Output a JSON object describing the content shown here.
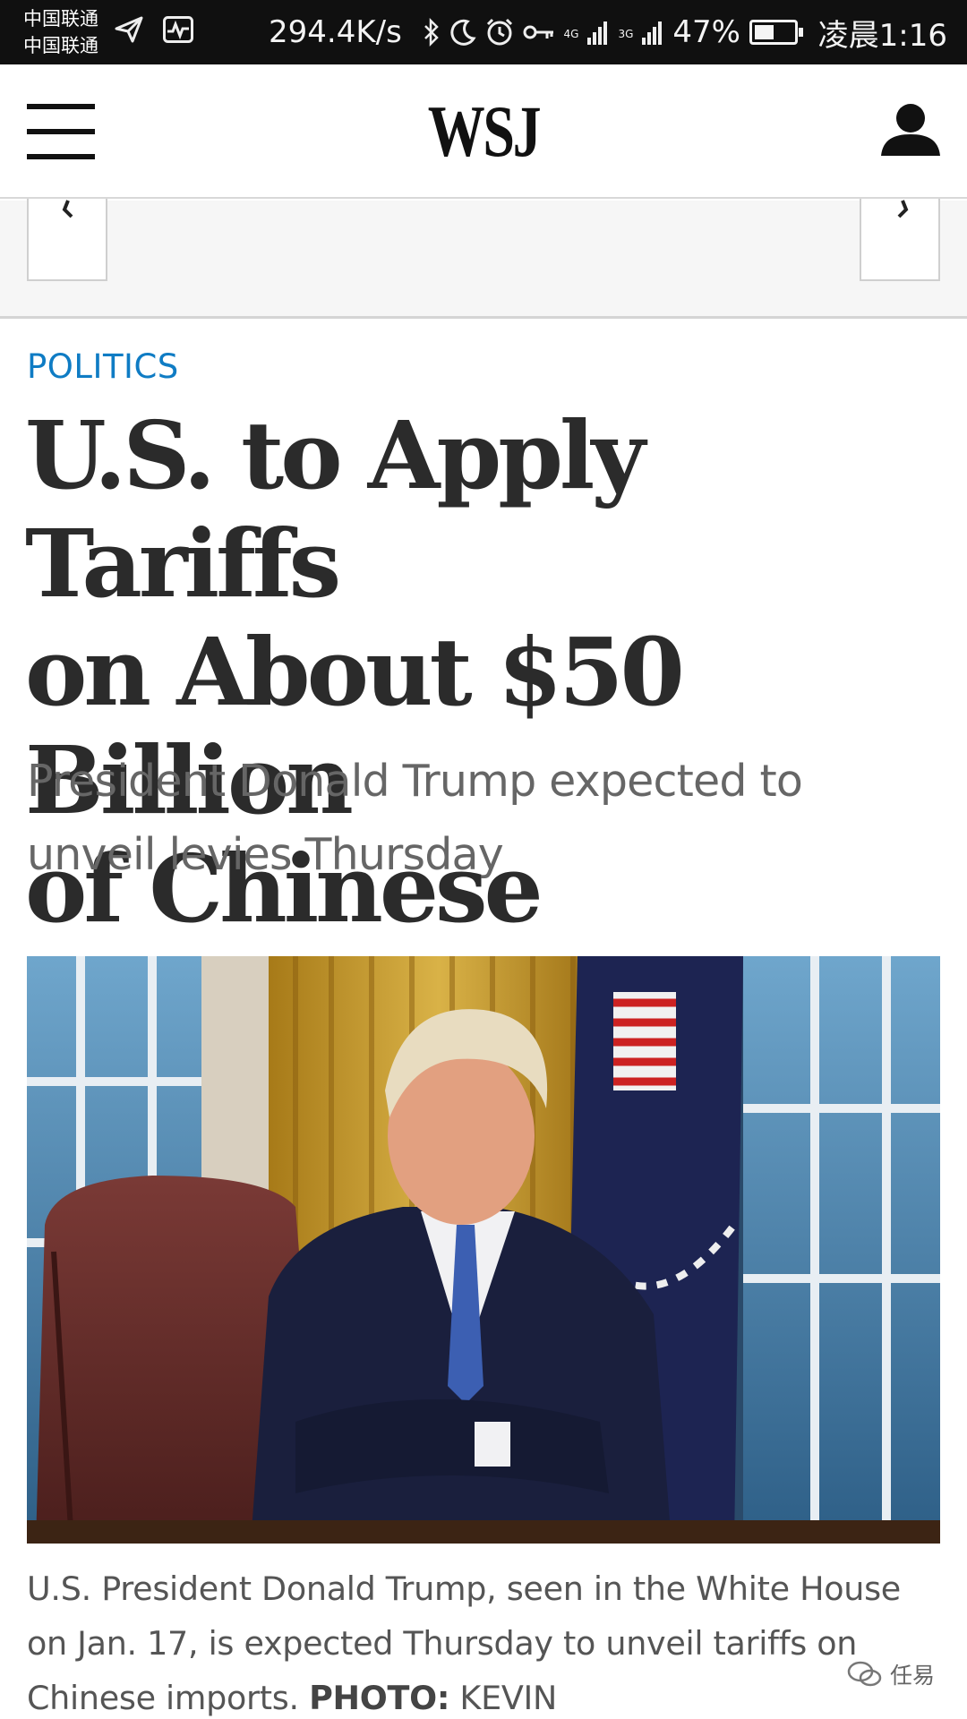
{
  "status_bar": {
    "carrier_1": "中国联通",
    "carrier_2": "中国联通",
    "speed": "294.4K/s",
    "network_1": "4G",
    "network_2": "3G",
    "battery": "47%",
    "battery_level": 0.47,
    "time": "凌晨1:16"
  },
  "header": {
    "logo": "WSJ"
  },
  "article": {
    "section": "POLITICS",
    "headline_lines": [
      "U.S. to Apply Tariffs",
      "on About $50 Billion",
      "of Chinese Imports"
    ],
    "dek_lines": [
      "President Donald Trump expected to",
      "unveil levies Thursday"
    ],
    "caption_lines": [
      "U.S. President Donald Trump, seen in the White House",
      "on Jan. 17, is expected Thursday to unveil tariffs on",
      "Chinese imports. "
    ],
    "credit_label": "PHOTO:",
    "credit_name": " KEVIN"
  },
  "watermark": {
    "text": "任易"
  },
  "colors": {
    "section_blue": "#0f7cc4",
    "headline": "#2b2b2b",
    "status_bar_bg": "#101010"
  }
}
